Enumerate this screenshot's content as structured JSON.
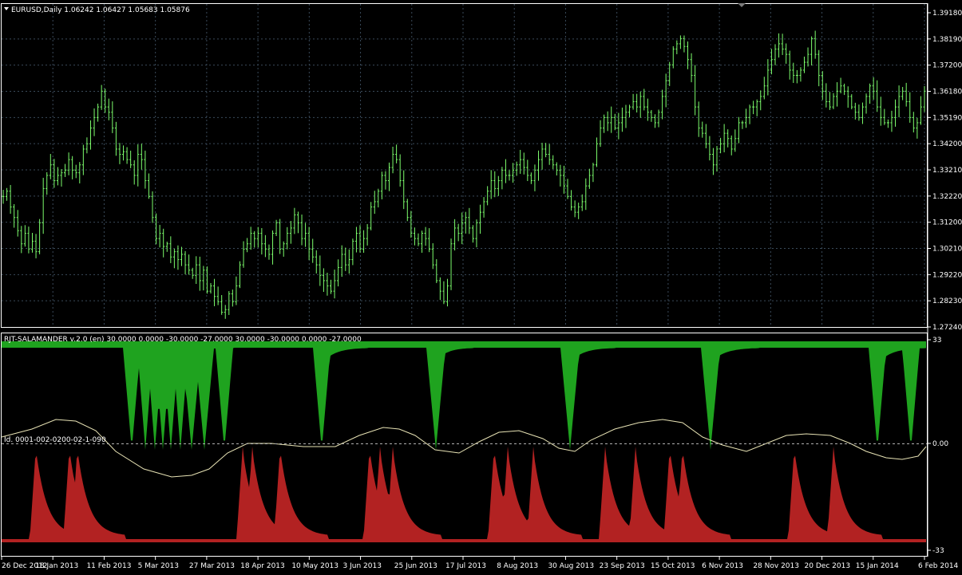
{
  "window": {
    "main_header": "EURUSD,Daily  1.06242 1.06427 1.05683 1.05876",
    "indicator_header": "RJT-SALAMANDER v.2.0 (en) 30.0000 0.0000 -30.0000 -27.0000 30.0000 -30.0000 0.0000 -27.0000",
    "indicator_id": "Id. 0001-002-0200-02-1-090"
  },
  "colors": {
    "background": "#000000",
    "grid": "#3a4a5a",
    "candle": "#7CFC6C",
    "green_fill": "#1fa31f",
    "red_fill": "#b22222",
    "line": "#e8e3b5",
    "frame": "#ffffff"
  },
  "price_axis_labels": [
    "1.39180",
    "1.38190",
    "1.37200",
    "1.36180",
    "1.35190",
    "1.34200",
    "1.33210",
    "1.32220",
    "1.31200",
    "1.30210",
    "1.29220",
    "1.28230",
    "1.27240"
  ],
  "indicator_axis_labels": [
    "33",
    "0.00",
    "-33"
  ],
  "date_axis_labels": [
    "26 Dec 2012",
    "18 Jan 2013",
    "11 Feb 2013",
    "5 Mar 2013",
    "27 Mar 2013",
    "18 Apr 2013",
    "10 May 2013",
    "3 Jun 2013",
    "25 Jun 2013",
    "17 Jul 2013",
    "8 Aug 2013",
    "30 Aug 2013",
    "23 Sep 2013",
    "15 Oct 2013",
    "6 Nov 2013",
    "28 Nov 2013",
    "20 Dec 2013",
    "15 Jan 2014",
    "6 Feb 2014"
  ],
  "chart_data": {
    "type": "line",
    "symbol": "EURUSD",
    "timeframe": "Daily",
    "price_ylim": [
      1.2724,
      1.3918
    ],
    "close_series": [
      1.322,
      1.324,
      1.318,
      1.314,
      1.309,
      1.304,
      1.308,
      1.302,
      1.305,
      1.301,
      1.312,
      1.325,
      1.33,
      1.334,
      1.328,
      1.33,
      1.331,
      1.332,
      1.336,
      1.332,
      1.331,
      1.334,
      1.34,
      1.342,
      1.348,
      1.352,
      1.356,
      1.362,
      1.356,
      1.354,
      1.348,
      1.34,
      1.338,
      1.339,
      1.336,
      1.334,
      1.33,
      1.338,
      1.336,
      1.328,
      1.322,
      1.314,
      1.306,
      1.308,
      1.303,
      1.304,
      1.299,
      1.301,
      1.298,
      1.3,
      1.296,
      1.294,
      1.292,
      1.296,
      1.29,
      1.294,
      1.286,
      1.288,
      1.284,
      1.282,
      1.278,
      1.279,
      1.285,
      1.282,
      1.288,
      1.296,
      1.302,
      1.304,
      1.308,
      1.306,
      1.308,
      1.304,
      1.302,
      1.3,
      1.308,
      1.312,
      1.302,
      1.304,
      1.308,
      1.31,
      1.315,
      1.312,
      1.306,
      1.308,
      1.302,
      1.299,
      1.296,
      1.292,
      1.29,
      1.288,
      1.286,
      1.29,
      1.295,
      1.3,
      1.296,
      1.298,
      1.305,
      1.308,
      1.302,
      1.306,
      1.31,
      1.318,
      1.32,
      1.324,
      1.33,
      1.328,
      1.333,
      1.338,
      1.336,
      1.328,
      1.32,
      1.314,
      1.308,
      1.306,
      1.304,
      1.308,
      1.306,
      1.302,
      1.296,
      1.29,
      1.286,
      1.282,
      1.288,
      1.304,
      1.31,
      1.308,
      1.312,
      1.314,
      1.31,
      1.306,
      1.312,
      1.316,
      1.32,
      1.324,
      1.328,
      1.325,
      1.328,
      1.332,
      1.33,
      1.33,
      1.332,
      1.334,
      1.336,
      1.333,
      1.33,
      1.328,
      1.332,
      1.336,
      1.34,
      1.338,
      1.336,
      1.334,
      1.332,
      1.33,
      1.326,
      1.322,
      1.318,
      1.316,
      1.318,
      1.32,
      1.326,
      1.33,
      1.334,
      1.342,
      1.348,
      1.352,
      1.35,
      1.352,
      1.348,
      1.35,
      1.352,
      1.354,
      1.356,
      1.358,
      1.356,
      1.36,
      1.356,
      1.354,
      1.352,
      1.35,
      1.354,
      1.36,
      1.366,
      1.372,
      1.378,
      1.38,
      1.382,
      1.379,
      1.374,
      1.368,
      1.356,
      1.348,
      1.346,
      1.342,
      1.338,
      1.334,
      1.34,
      1.342,
      1.346,
      1.344,
      1.34,
      1.344,
      1.35,
      1.35,
      1.352,
      1.356,
      1.356,
      1.358,
      1.36,
      1.364,
      1.37,
      1.374,
      1.378,
      1.38,
      1.378,
      1.376,
      1.37,
      1.368,
      1.368,
      1.37,
      1.373,
      1.376,
      1.382,
      1.376,
      1.368,
      1.362,
      1.358,
      1.356,
      1.36,
      1.362,
      1.364,
      1.362,
      1.36,
      1.356,
      1.354,
      1.352,
      1.356,
      1.36,
      1.364,
      1.362,
      1.356,
      1.352,
      1.35,
      1.35,
      1.352,
      1.356,
      1.36,
      1.362,
      1.358,
      1.352,
      1.348,
      1.35,
      1.356,
      1.362
    ],
    "indicator_ylim": [
      -33,
      33
    ]
  }
}
